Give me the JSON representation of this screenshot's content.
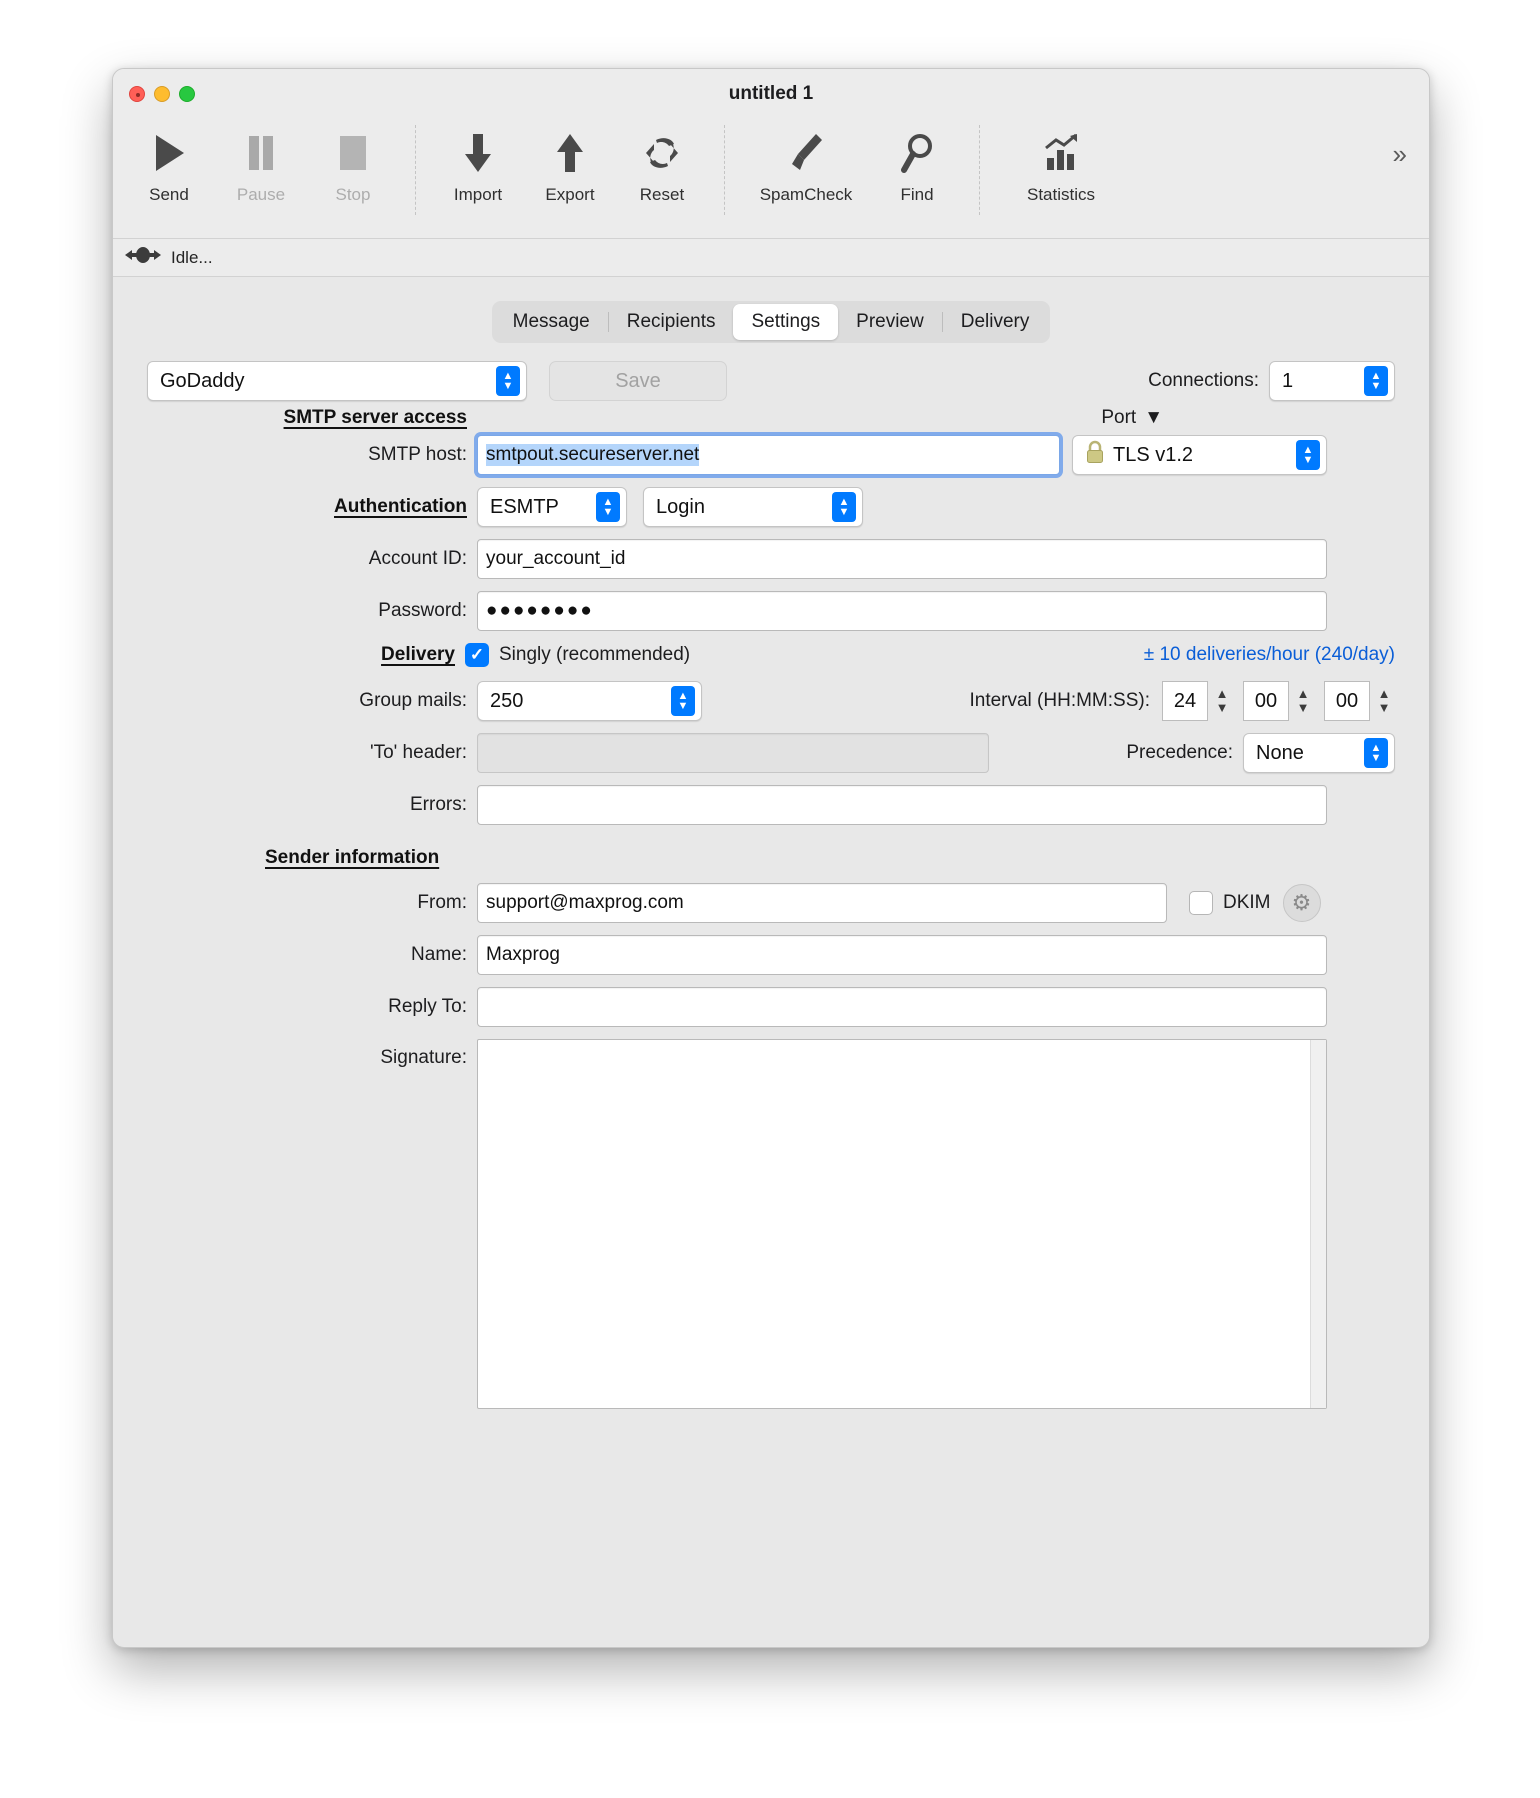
{
  "window": {
    "title": "untitled 1",
    "traffic_lights": [
      "close",
      "minimize",
      "zoom"
    ]
  },
  "toolbar": {
    "items": [
      {
        "label": "Send",
        "icon": "play-icon",
        "enabled": true
      },
      {
        "label": "Pause",
        "icon": "pause-icon",
        "enabled": false
      },
      {
        "label": "Stop",
        "icon": "stop-icon",
        "enabled": false
      },
      {
        "label": "Import",
        "icon": "arrow-down-icon",
        "enabled": true
      },
      {
        "label": "Export",
        "icon": "arrow-up-icon",
        "enabled": true
      },
      {
        "label": "Reset",
        "icon": "refresh-icon",
        "enabled": true
      },
      {
        "label": "SpamCheck",
        "icon": "brush-icon",
        "enabled": true
      },
      {
        "label": "Find",
        "icon": "magnifier-icon",
        "enabled": true
      },
      {
        "label": "Statistics",
        "icon": "chart-icon",
        "enabled": true
      }
    ],
    "overflow": "»"
  },
  "statusbar": {
    "icon": "plug-connector-icon",
    "text": "Idle..."
  },
  "tabs": {
    "items": [
      "Message",
      "Recipients",
      "Settings",
      "Preview",
      "Delivery"
    ],
    "active": "Settings"
  },
  "settings": {
    "profile": {
      "value": "GoDaddy"
    },
    "save_button": "Save",
    "connections": {
      "label": "Connections:",
      "value": "1"
    },
    "smtp_section": "SMTP server access",
    "port_label": "Port",
    "smtp_host": {
      "label": "SMTP host:",
      "value": "smtpout.secureserver.net"
    },
    "tls": {
      "value": "TLS v1.2",
      "icon": "lock-icon"
    },
    "authentication": {
      "label": "Authentication",
      "protocol": "ESMTP",
      "method": "Login"
    },
    "account_id": {
      "label": "Account ID:",
      "value": "your_account_id"
    },
    "password": {
      "label": "Password:",
      "value": "●●●●●●●●"
    },
    "delivery": {
      "label": "Delivery",
      "singly_label": "Singly (recommended)",
      "singly_checked": true,
      "rate_note": "± 10 deliveries/hour (240/day)",
      "group_mails": {
        "label": "Group mails:",
        "value": "250"
      },
      "interval": {
        "label": "Interval (HH:MM:SS):",
        "hours": "24",
        "minutes": "00",
        "seconds": "00"
      }
    },
    "to_header": {
      "label": "'To' header:",
      "value": ""
    },
    "precedence": {
      "label": "Precedence:",
      "value": "None"
    },
    "errors": {
      "label": "Errors:",
      "value": ""
    },
    "sender_section": "Sender information",
    "from": {
      "label": "From:",
      "value": "support@maxprog.com"
    },
    "dkim": {
      "label": "DKIM",
      "checked": false,
      "settings_icon": "gear-icon"
    },
    "name": {
      "label": "Name:",
      "value": "Maxprog"
    },
    "reply_to": {
      "label": "Reply To:",
      "value": ""
    },
    "signature": {
      "label": "Signature:",
      "value": ""
    }
  },
  "colors": {
    "accent": "#007aff",
    "link": "#0a5ed7",
    "selection": "#b4d5fb",
    "window_bg": "#e8e8e8"
  }
}
